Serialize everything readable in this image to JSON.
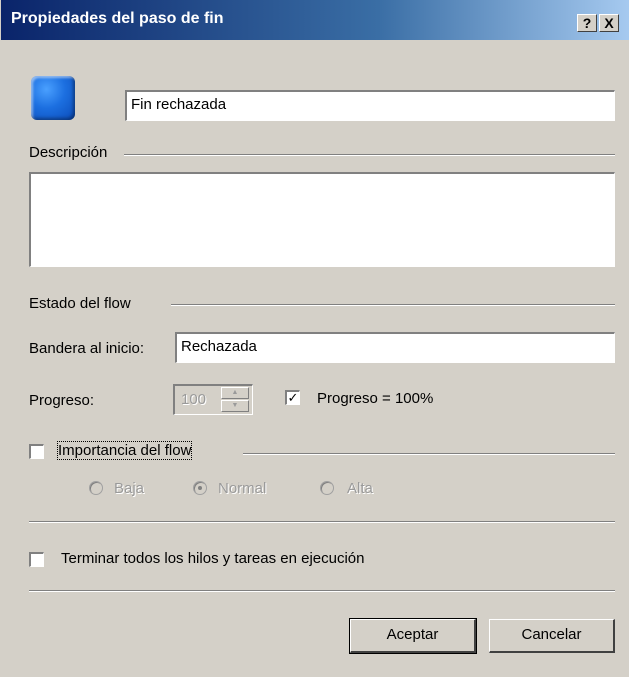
{
  "window": {
    "title": "Propiedades del paso de fin",
    "help_label": "?",
    "close_label": "X"
  },
  "name_field": {
    "value": "Fin rechazada"
  },
  "description": {
    "label": "Descripción",
    "value": ""
  },
  "flow_state": {
    "label": "Estado del flow",
    "flag_label": "Bandera al inicio:",
    "flag_value": "Rechazada"
  },
  "progress": {
    "label": "Progreso:",
    "value": "100",
    "checkbox_label": "Progreso = 100%",
    "checkbox_checked": true
  },
  "importance": {
    "checkbox_label": "Importancia del flow",
    "checkbox_checked": false,
    "options": [
      {
        "label": "Baja",
        "selected": false
      },
      {
        "label": "Normal",
        "selected": true
      },
      {
        "label": "Alta",
        "selected": false
      }
    ]
  },
  "terminate": {
    "checkbox_label": "Terminar todos los hilos y tareas en ejecución",
    "checkbox_checked": false
  },
  "buttons": {
    "accept": "Aceptar",
    "cancel": "Cancelar"
  },
  "icons": {
    "step": "blue-square-step-icon"
  },
  "colors": {
    "titlebar_start": "#0a246a",
    "titlebar_end": "#a6caf0",
    "dialog_bg": "#d4d0c8"
  }
}
